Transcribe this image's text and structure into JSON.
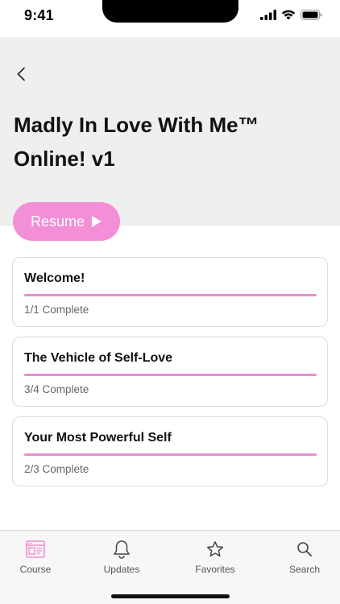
{
  "status_bar": {
    "time": "9:41"
  },
  "course": {
    "title": "Madly In Love With Me™ Online! v1"
  },
  "resume_button": {
    "label": "Resume"
  },
  "modules": [
    {
      "title": "Welcome!",
      "status": "1/1 Complete",
      "progress": 1.0
    },
    {
      "title": "The Vehicle of Self-Love",
      "status": "3/4 Complete",
      "progress": 1.0
    },
    {
      "title": "Your Most Powerful Self",
      "status": "2/3 Complete",
      "progress": 1.0
    }
  ],
  "tabs": [
    {
      "label": "Course",
      "icon": "course-icon",
      "active": true
    },
    {
      "label": "Updates",
      "icon": "bell-icon",
      "active": false
    },
    {
      "label": "Favorites",
      "icon": "star-icon",
      "active": false
    },
    {
      "label": "Search",
      "icon": "search-icon",
      "active": false
    }
  ],
  "colors": {
    "accent": "#f28fd6",
    "progress": "#e98fd0",
    "header_bg": "#efefef"
  }
}
